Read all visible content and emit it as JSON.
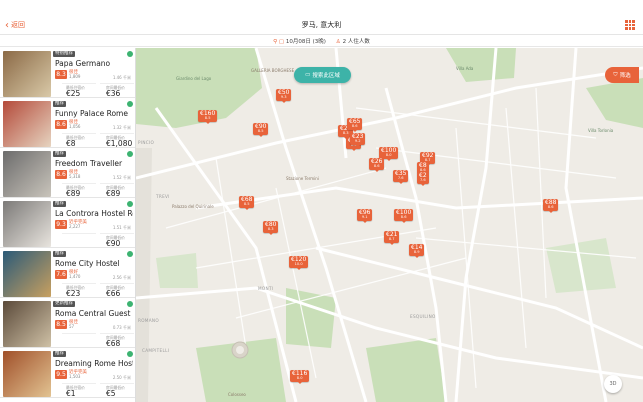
{
  "header": {
    "back_label": "返回",
    "title": "罗马, 意大利",
    "date_range": "10月08日 (3晚)",
    "guests": "2 人住人数"
  },
  "map_controls": {
    "search_area_label": "搜索此区域",
    "filter_label": "筛选",
    "compass_label": "3D"
  },
  "hostels": [
    {
      "tag": "特别推荐",
      "name": "Papa Germano",
      "score": "8.3",
      "rating_label": "很佳",
      "reviews": "1,809",
      "distance": "1.46 千米",
      "label_left": "最低住宿价",
      "price_left": "€25",
      "label_right": "房间最低价",
      "price_right": "€36"
    },
    {
      "tag": "推荐",
      "name": "Funny Palace Rome",
      "score": "8.6",
      "rating_label": "很佳",
      "reviews": "1,056",
      "distance": "1.32 千米",
      "label_left": "最低住宿价",
      "price_left": "€8",
      "label_right": "房间最低价",
      "price_right": "€1,080"
    },
    {
      "tag": "推荐",
      "name": "Freedom Traveller",
      "score": "8.6",
      "rating_label": "很佳",
      "reviews": "5,318",
      "distance": "1.52 千米",
      "label_left": "最低住宿价",
      "price_left": "€89",
      "label_right": "房间最低价",
      "price_right": "€89"
    },
    {
      "tag": "推荐",
      "name": "La Controra Hostel Rome",
      "score": "9.3",
      "rating_label": "近乎完美",
      "reviews": "2,227",
      "distance": "1.51 千米",
      "label_left": "",
      "price_left": "",
      "label_right": "房间最低价",
      "price_right": "€90"
    },
    {
      "tag": "推荐",
      "name": "Rome City Hostel",
      "score": "7.6",
      "rating_label": "很好",
      "reviews": "1,470",
      "distance": "2.56 千米",
      "label_left": "最低住宿价",
      "price_left": "€23",
      "label_right": "房间最低价",
      "price_right": "€66"
    },
    {
      "tag": "更新推荐",
      "name": "Roma Central Guest Hou...",
      "score": "8.5",
      "rating_label": "很佳",
      "reviews": "57",
      "distance": "0.73 千米",
      "label_left": "",
      "price_left": "",
      "label_right": "房间最低价",
      "price_right": "€68"
    },
    {
      "tag": "推荐",
      "name": "Dreaming Rome Hostel",
      "score": "9.5",
      "rating_label": "近乎完美",
      "reviews": "1,503",
      "distance": "2.50 千米",
      "label_left": "最低住宿价",
      "price_left": "€1",
      "label_right": "房间最低价",
      "price_right": "€5"
    }
  ],
  "pins": [
    {
      "price": "€50",
      "score": "9.3"
    },
    {
      "price": "€160",
      "score": "8.5"
    },
    {
      "price": "€90",
      "score": "8.5"
    },
    {
      "price": "€25",
      "score": "8.3"
    },
    {
      "price": "€65",
      "score": "8.6"
    },
    {
      "price": "€89",
      "score": "8.6"
    },
    {
      "price": "€23",
      "score": "9.2"
    },
    {
      "price": "€100",
      "score": "8.0"
    },
    {
      "price": "€26",
      "score": "8.6"
    },
    {
      "price": "€35",
      "score": "7.6"
    },
    {
      "price": "€92",
      "score": "8.7"
    },
    {
      "price": "€8",
      "score": "8.6"
    },
    {
      "price": "€2",
      "score": "7.6"
    },
    {
      "price": "€68",
      "score": "8.5"
    },
    {
      "price": "€96",
      "score": "9.1"
    },
    {
      "price": "€100",
      "score": "8.6"
    },
    {
      "price": "€80",
      "score": "8.3"
    },
    {
      "price": "€21",
      "score": "8.7"
    },
    {
      "price": "€14",
      "score": "8.9"
    },
    {
      "price": "€88",
      "score": "8.6"
    },
    {
      "price": "€120",
      "score": "10.0"
    },
    {
      "price": "€116",
      "score": "8.0"
    }
  ],
  "map_labels": {
    "villa_borghese": "Giardino del Lago",
    "galleria_borghese": "GALLERIA BORGHESE",
    "villa_ada": "Villa Ada",
    "villa_torlonia": "Villa Torlonia",
    "pincio": "PINCIO",
    "trevi": "TREVI",
    "monti": "MONTI",
    "esquilino": "ESQUILINO",
    "campitelli": "CAMPITELLI",
    "termini": "Stazione Termini",
    "colosseo": "Colosseo",
    "quirinale": "Palazzo del Quirinale",
    "rione": "ROMANO"
  },
  "colors": {
    "accent": "#e8633a",
    "teal": "#3db3a8",
    "park": "#c9dfb8",
    "road": "#ffffff"
  }
}
